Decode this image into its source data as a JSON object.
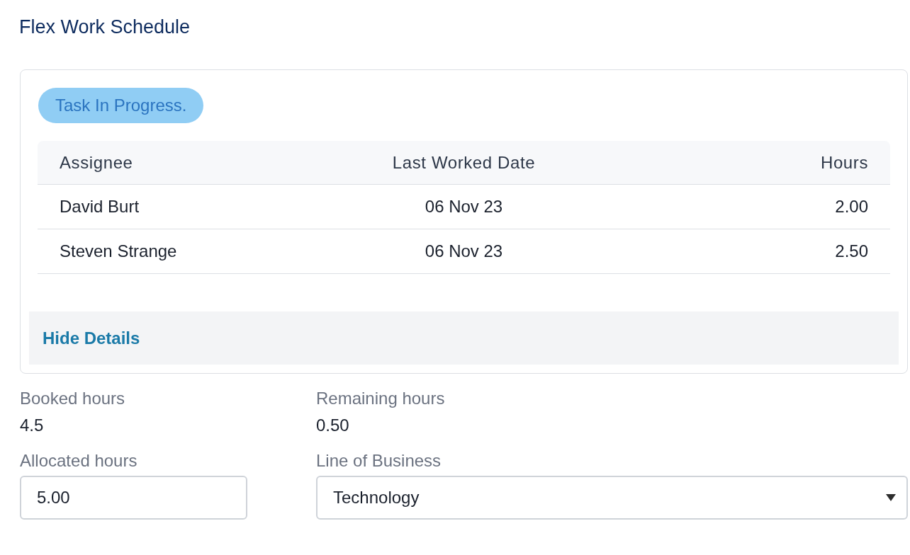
{
  "title": "Flex Work Schedule",
  "status_badge": "Task In Progress.",
  "table": {
    "columns": [
      "Assignee",
      "Last Worked Date",
      "Hours"
    ],
    "rows": [
      [
        "David Burt",
        "06 Nov 23",
        "2.00"
      ],
      [
        "Steven Strange",
        "06 Nov 23",
        "2.50"
      ]
    ]
  },
  "details_toggle": "Hide Details",
  "summary": [
    {
      "label": "Booked hours",
      "value": "4.5"
    },
    {
      "label": "Remaining hours",
      "value": "0.50"
    }
  ],
  "fields": [
    {
      "kind": "input",
      "label": "Allocated hours",
      "value": "5.00"
    },
    {
      "kind": "select",
      "label": "Line of Business",
      "value": "Technology"
    }
  ]
}
